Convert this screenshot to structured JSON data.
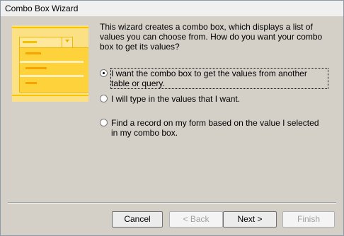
{
  "window": {
    "title": "Combo Box Wizard"
  },
  "intro": "This wizard creates a combo box, which displays a list of values you can choose from.  How do you want your combo box to get its values?",
  "options": [
    {
      "label": "I want the combo box to get the values from another table or query.",
      "selected": true
    },
    {
      "label": "I will type in the values that I want.",
      "selected": false
    },
    {
      "label": "Find a record on my form based on the value I selected in my combo box.",
      "selected": false
    }
  ],
  "buttons": {
    "cancel": "Cancel",
    "back": "< Back",
    "next": "Next >",
    "finish": "Finish"
  },
  "colors": {
    "dialog_bg": "#d4d0c8",
    "illustration_yellow": "#fbe184",
    "illustration_orange": "#f8a400"
  }
}
